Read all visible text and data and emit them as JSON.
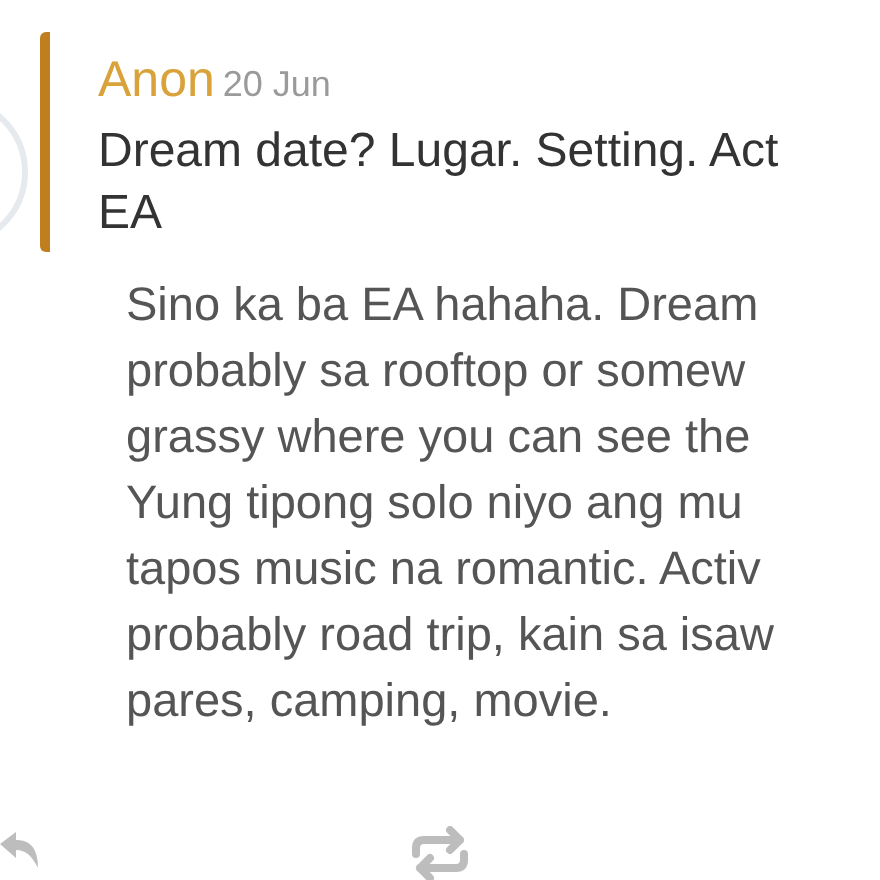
{
  "post": {
    "author": "Anon",
    "date": "20 Jun",
    "question_lines": [
      "Dream date? Lugar. Setting. Act",
      "EA"
    ],
    "answer_lines": [
      "Sino ka ba EA hahaha. Dream",
      "probably sa rooftop or somew",
      "grassy where you can see the",
      "Yung tipong solo niyo ang mu",
      "tapos music na romantic. Activ",
      "probably road trip, kain sa isaw",
      "pares, camping, movie."
    ]
  }
}
